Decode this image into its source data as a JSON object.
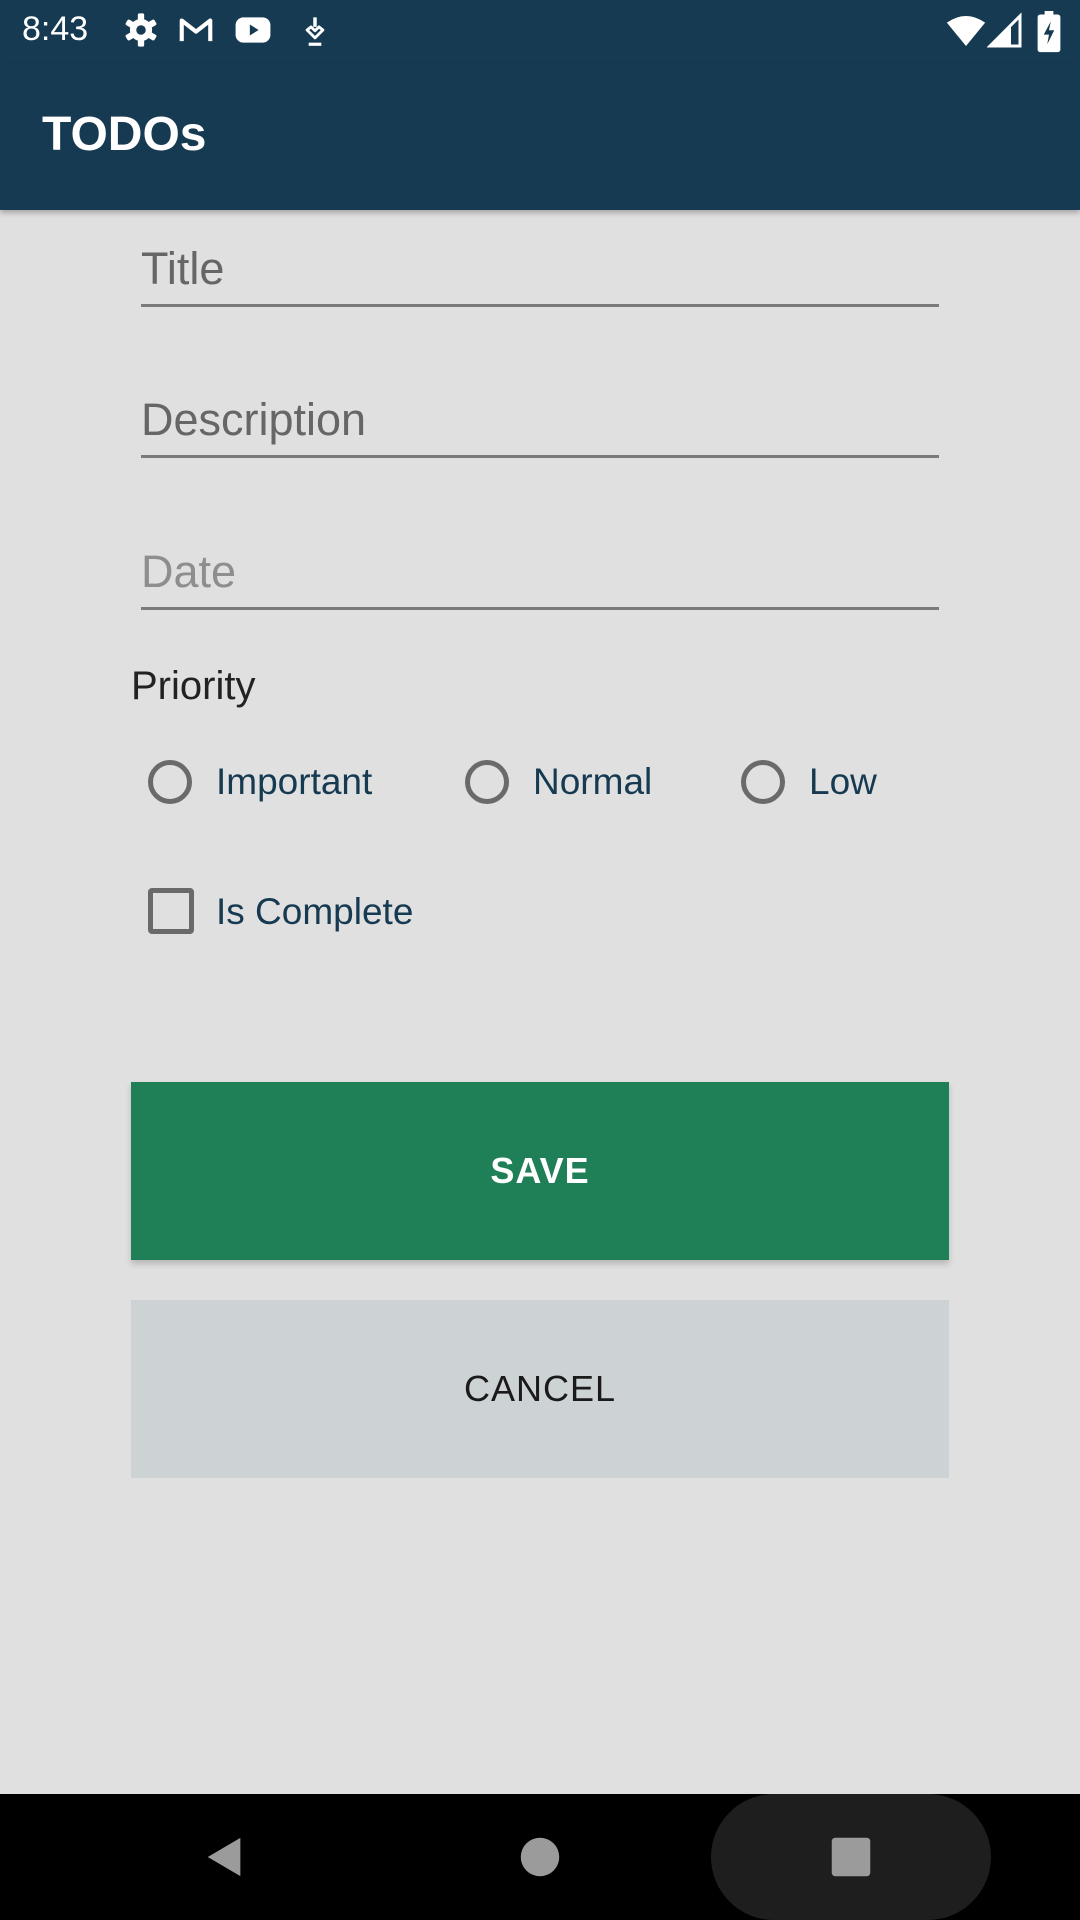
{
  "status_bar": {
    "time": "8:43",
    "left_icons": [
      "settings-icon",
      "gmail-icon",
      "youtube-icon",
      "download-icon"
    ],
    "right_icons": [
      "wifi-icon",
      "signal-icon",
      "battery-charging-icon"
    ]
  },
  "app_bar": {
    "title": "TODOs"
  },
  "form": {
    "title_placeholder": "Title",
    "description_placeholder": "Description",
    "date_placeholder": "Date",
    "priority_label": "Priority",
    "priority_options": [
      "Important",
      "Normal",
      "Low"
    ],
    "complete_label": "Is Complete"
  },
  "actions": {
    "save_label": "SAVE",
    "cancel_label": "CANCEL"
  },
  "nav": {
    "icons": [
      "back-icon",
      "home-icon",
      "recents-icon"
    ]
  },
  "colors": {
    "app_bar": "#163a51",
    "save_button": "#1f7f56",
    "cancel_button": "#cdd2d5",
    "background": "#e0e0e0"
  }
}
